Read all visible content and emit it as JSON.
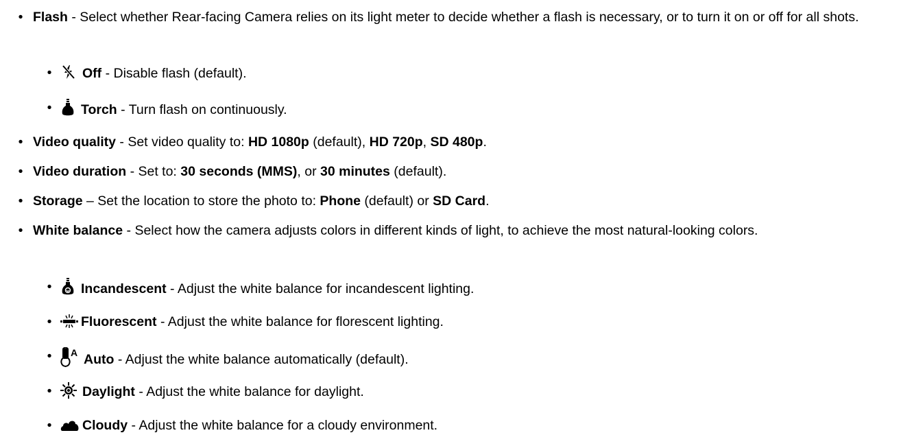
{
  "items": [
    {
      "term": "Flash",
      "text": " - Select whether Rear-facing Camera relies on its light meter to decide whether a flash is necessary, or to turn it on or off for all shots."
    },
    {
      "term": "Off",
      "text": " - Disable flash (default).",
      "icon": "flash-off-icon"
    },
    {
      "term": "Torch",
      "text": " - Turn flash on continuously.",
      "icon": "torch-icon"
    },
    {
      "term": "Video quality",
      "text": " - Set video quality to: ",
      "v1": "HD 1080p",
      "t1": " (default), ",
      "v2": "HD 720p",
      "t2": ", ",
      "v3": "SD 480p",
      "t3": "."
    },
    {
      "term": "Video duration",
      "text": " - Set to: ",
      "v1": "30 seconds (MMS)",
      "t1": ", or ",
      "v2": "30 minutes",
      "t2": " (default)."
    },
    {
      "term": "Storage",
      "text": " – Set the location to store the photo to: ",
      "v1": "Phone",
      "t1": " (default) or ",
      "v2": "SD Card",
      "t2": "."
    },
    {
      "term": "White balance",
      "text": " - Select how the camera adjusts colors in different kinds of light, to achieve the most natural-looking colors."
    },
    {
      "term": "Incandescent",
      "text": " - Adjust the white balance for incandescent lighting.",
      "icon": "incandescent-bulb-icon"
    },
    {
      "term": "Fluorescent",
      "text": " - Adjust the white balance for florescent lighting.",
      "icon": "fluorescent-tube-icon"
    },
    {
      "term": "Auto",
      "text": " - Adjust the white balance automatically (default).",
      "icon": "auto-white-balance-icon"
    },
    {
      "term": "Daylight",
      "text": " - Adjust the white balance for daylight.",
      "icon": "sun-icon"
    },
    {
      "term": "Cloudy",
      "text": " - Adjust the white balance for a cloudy environment.",
      "icon": "cloud-icon"
    }
  ],
  "bullet": "•",
  "icon_letter_auto": "A"
}
